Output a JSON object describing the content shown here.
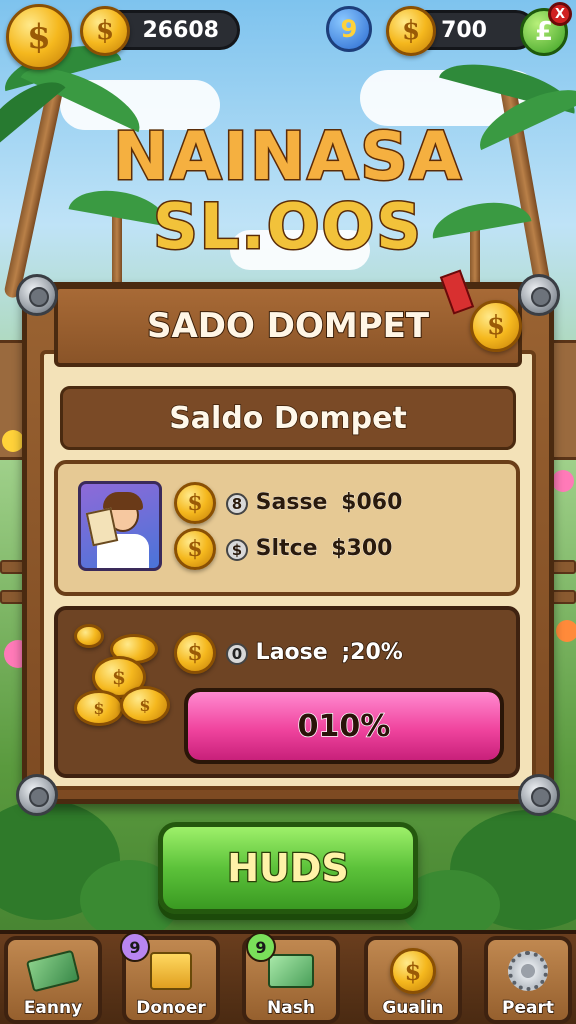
{
  "top_bar": {
    "balance": "26608",
    "level": "9",
    "coins": "700",
    "plus_symbol": "£",
    "close_symbol": "X"
  },
  "title": {
    "line1": "NAINASA",
    "line2": "SL.OOS"
  },
  "board": {
    "header": "SADO DOMPET",
    "subheader": "Saldo Dompet",
    "rows": [
      {
        "prefix": "8",
        "label": "Sasse",
        "value": "$060"
      },
      {
        "prefix": "$",
        "label": "Sltce",
        "value": "$300"
      }
    ],
    "bonus": {
      "prefix": "0",
      "label": "Laose",
      "value": ";20%"
    },
    "progress": {
      "label": "010%",
      "fraction": 1.0
    }
  },
  "main_button": "HUDS",
  "nav": [
    {
      "label": "Eanny",
      "badge": ""
    },
    {
      "label": "Donoer",
      "badge": "9"
    },
    {
      "label": "Nash",
      "badge": "9"
    },
    {
      "label": "Gualin",
      "badge": ""
    },
    {
      "label": "Peart",
      "badge": ""
    }
  ],
  "colors": {
    "coin_gold": "#f5b81e",
    "progress_pink": "#f0449e",
    "button_green": "#5cc23a",
    "wood": "#8a5428"
  },
  "icons": [
    "coin-icon",
    "level-badge-icon",
    "plus-icon",
    "close-icon",
    "medal-icon",
    "money-stack-icon",
    "gift-box-icon",
    "cash-bundle-icon",
    "coin-bag-icon",
    "gear-icon"
  ]
}
